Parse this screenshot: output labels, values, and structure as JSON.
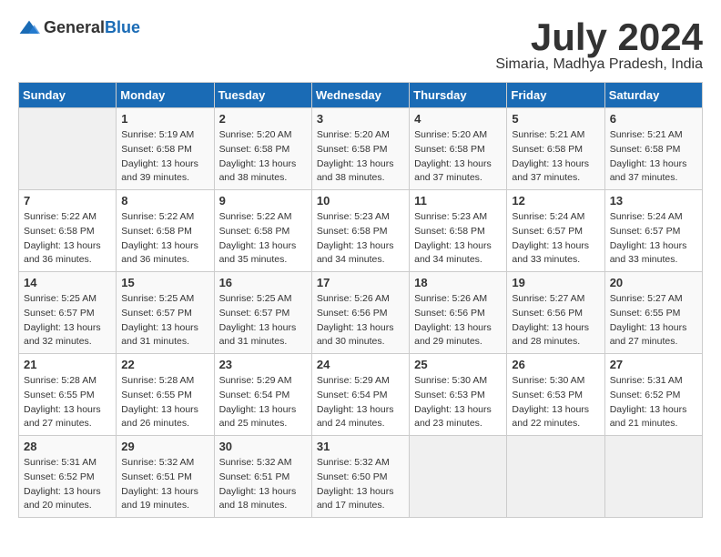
{
  "logo": {
    "text_general": "General",
    "text_blue": "Blue"
  },
  "title": "July 2024",
  "subtitle": "Simaria, Madhya Pradesh, India",
  "days_of_week": [
    "Sunday",
    "Monday",
    "Tuesday",
    "Wednesday",
    "Thursday",
    "Friday",
    "Saturday"
  ],
  "weeks": [
    [
      {
        "day": "",
        "info": ""
      },
      {
        "day": "1",
        "info": "Sunrise: 5:19 AM\nSunset: 6:58 PM\nDaylight: 13 hours\nand 39 minutes."
      },
      {
        "day": "2",
        "info": "Sunrise: 5:20 AM\nSunset: 6:58 PM\nDaylight: 13 hours\nand 38 minutes."
      },
      {
        "day": "3",
        "info": "Sunrise: 5:20 AM\nSunset: 6:58 PM\nDaylight: 13 hours\nand 38 minutes."
      },
      {
        "day": "4",
        "info": "Sunrise: 5:20 AM\nSunset: 6:58 PM\nDaylight: 13 hours\nand 37 minutes."
      },
      {
        "day": "5",
        "info": "Sunrise: 5:21 AM\nSunset: 6:58 PM\nDaylight: 13 hours\nand 37 minutes."
      },
      {
        "day": "6",
        "info": "Sunrise: 5:21 AM\nSunset: 6:58 PM\nDaylight: 13 hours\nand 37 minutes."
      }
    ],
    [
      {
        "day": "7",
        "info": "Sunrise: 5:22 AM\nSunset: 6:58 PM\nDaylight: 13 hours\nand 36 minutes."
      },
      {
        "day": "8",
        "info": "Sunrise: 5:22 AM\nSunset: 6:58 PM\nDaylight: 13 hours\nand 36 minutes."
      },
      {
        "day": "9",
        "info": "Sunrise: 5:22 AM\nSunset: 6:58 PM\nDaylight: 13 hours\nand 35 minutes."
      },
      {
        "day": "10",
        "info": "Sunrise: 5:23 AM\nSunset: 6:58 PM\nDaylight: 13 hours\nand 34 minutes."
      },
      {
        "day": "11",
        "info": "Sunrise: 5:23 AM\nSunset: 6:58 PM\nDaylight: 13 hours\nand 34 minutes."
      },
      {
        "day": "12",
        "info": "Sunrise: 5:24 AM\nSunset: 6:57 PM\nDaylight: 13 hours\nand 33 minutes."
      },
      {
        "day": "13",
        "info": "Sunrise: 5:24 AM\nSunset: 6:57 PM\nDaylight: 13 hours\nand 33 minutes."
      }
    ],
    [
      {
        "day": "14",
        "info": "Sunrise: 5:25 AM\nSunset: 6:57 PM\nDaylight: 13 hours\nand 32 minutes."
      },
      {
        "day": "15",
        "info": "Sunrise: 5:25 AM\nSunset: 6:57 PM\nDaylight: 13 hours\nand 31 minutes."
      },
      {
        "day": "16",
        "info": "Sunrise: 5:25 AM\nSunset: 6:57 PM\nDaylight: 13 hours\nand 31 minutes."
      },
      {
        "day": "17",
        "info": "Sunrise: 5:26 AM\nSunset: 6:56 PM\nDaylight: 13 hours\nand 30 minutes."
      },
      {
        "day": "18",
        "info": "Sunrise: 5:26 AM\nSunset: 6:56 PM\nDaylight: 13 hours\nand 29 minutes."
      },
      {
        "day": "19",
        "info": "Sunrise: 5:27 AM\nSunset: 6:56 PM\nDaylight: 13 hours\nand 28 minutes."
      },
      {
        "day": "20",
        "info": "Sunrise: 5:27 AM\nSunset: 6:55 PM\nDaylight: 13 hours\nand 27 minutes."
      }
    ],
    [
      {
        "day": "21",
        "info": "Sunrise: 5:28 AM\nSunset: 6:55 PM\nDaylight: 13 hours\nand 27 minutes."
      },
      {
        "day": "22",
        "info": "Sunrise: 5:28 AM\nSunset: 6:55 PM\nDaylight: 13 hours\nand 26 minutes."
      },
      {
        "day": "23",
        "info": "Sunrise: 5:29 AM\nSunset: 6:54 PM\nDaylight: 13 hours\nand 25 minutes."
      },
      {
        "day": "24",
        "info": "Sunrise: 5:29 AM\nSunset: 6:54 PM\nDaylight: 13 hours\nand 24 minutes."
      },
      {
        "day": "25",
        "info": "Sunrise: 5:30 AM\nSunset: 6:53 PM\nDaylight: 13 hours\nand 23 minutes."
      },
      {
        "day": "26",
        "info": "Sunrise: 5:30 AM\nSunset: 6:53 PM\nDaylight: 13 hours\nand 22 minutes."
      },
      {
        "day": "27",
        "info": "Sunrise: 5:31 AM\nSunset: 6:52 PM\nDaylight: 13 hours\nand 21 minutes."
      }
    ],
    [
      {
        "day": "28",
        "info": "Sunrise: 5:31 AM\nSunset: 6:52 PM\nDaylight: 13 hours\nand 20 minutes."
      },
      {
        "day": "29",
        "info": "Sunrise: 5:32 AM\nSunset: 6:51 PM\nDaylight: 13 hours\nand 19 minutes."
      },
      {
        "day": "30",
        "info": "Sunrise: 5:32 AM\nSunset: 6:51 PM\nDaylight: 13 hours\nand 18 minutes."
      },
      {
        "day": "31",
        "info": "Sunrise: 5:32 AM\nSunset: 6:50 PM\nDaylight: 13 hours\nand 17 minutes."
      },
      {
        "day": "",
        "info": ""
      },
      {
        "day": "",
        "info": ""
      },
      {
        "day": "",
        "info": ""
      }
    ]
  ]
}
